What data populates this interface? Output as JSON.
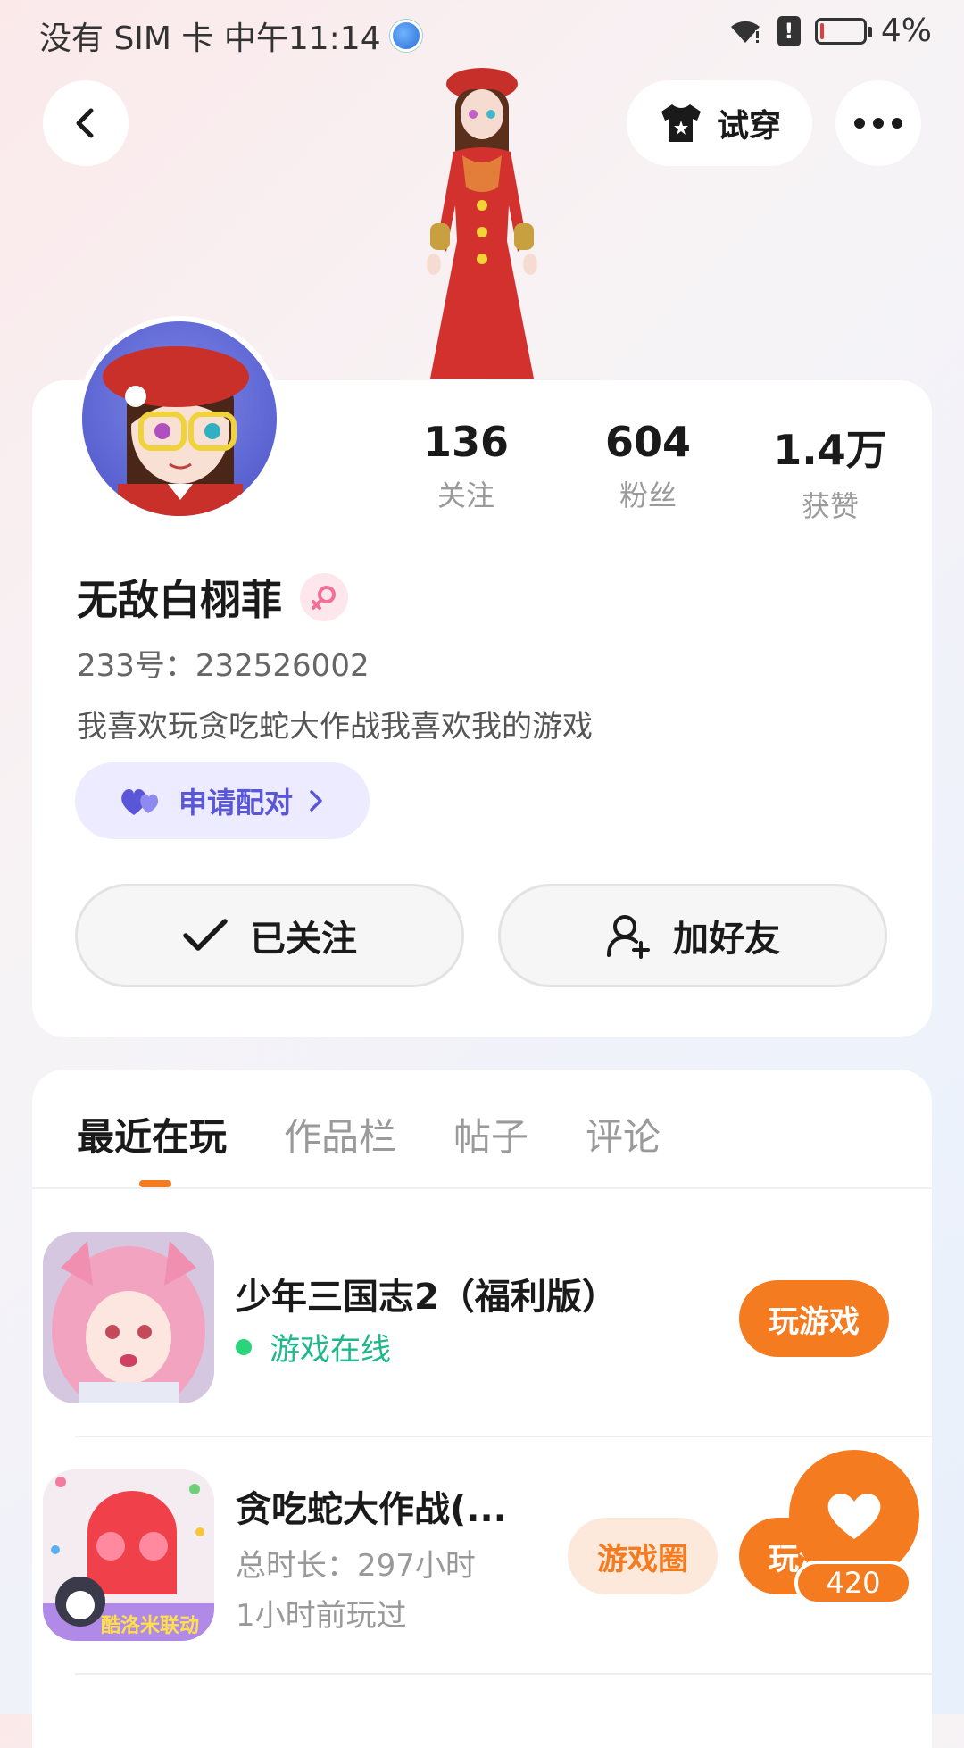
{
  "status_bar": {
    "left_text": "没有 SIM 卡 中午11:14",
    "battery": "4%",
    "battery_level": 0.04
  },
  "header": {
    "try_on_label": "试穿"
  },
  "profile": {
    "stats": [
      {
        "value": "136",
        "label": "关注"
      },
      {
        "value": "604",
        "label": "粉丝"
      },
      {
        "value": "1.4万",
        "label": "获赞"
      }
    ],
    "username": "无敌白栩菲",
    "uid": "233号：232526002",
    "bio": "我喜欢玩贪吃蛇大作战我喜欢我的游戏",
    "pair_label": "申请配对",
    "follow_label": "已关注",
    "add_friend_label": "加好友"
  },
  "tabs": [
    {
      "label": "最近在玩",
      "active": true
    },
    {
      "label": "作品栏",
      "active": false
    },
    {
      "label": "帖子",
      "active": false
    },
    {
      "label": "评论",
      "active": false
    }
  ],
  "games": [
    {
      "title": "少年三国志2（福利版）",
      "status": "游戏在线",
      "play_label": "玩游戏"
    },
    {
      "title": "贪吃蛇大作战(...",
      "duration": "总时长：297小时",
      "last_played": "1小时前玩过",
      "circle_label": "游戏圈",
      "play_label": "玩游戏",
      "icon_badge": "酷洛米联动"
    }
  ],
  "like_count": "420",
  "colors": {
    "accent": "#f47b20",
    "pair_bg": "#ecebff",
    "pair_text": "#5a56d8",
    "online": "#1fb88a"
  }
}
